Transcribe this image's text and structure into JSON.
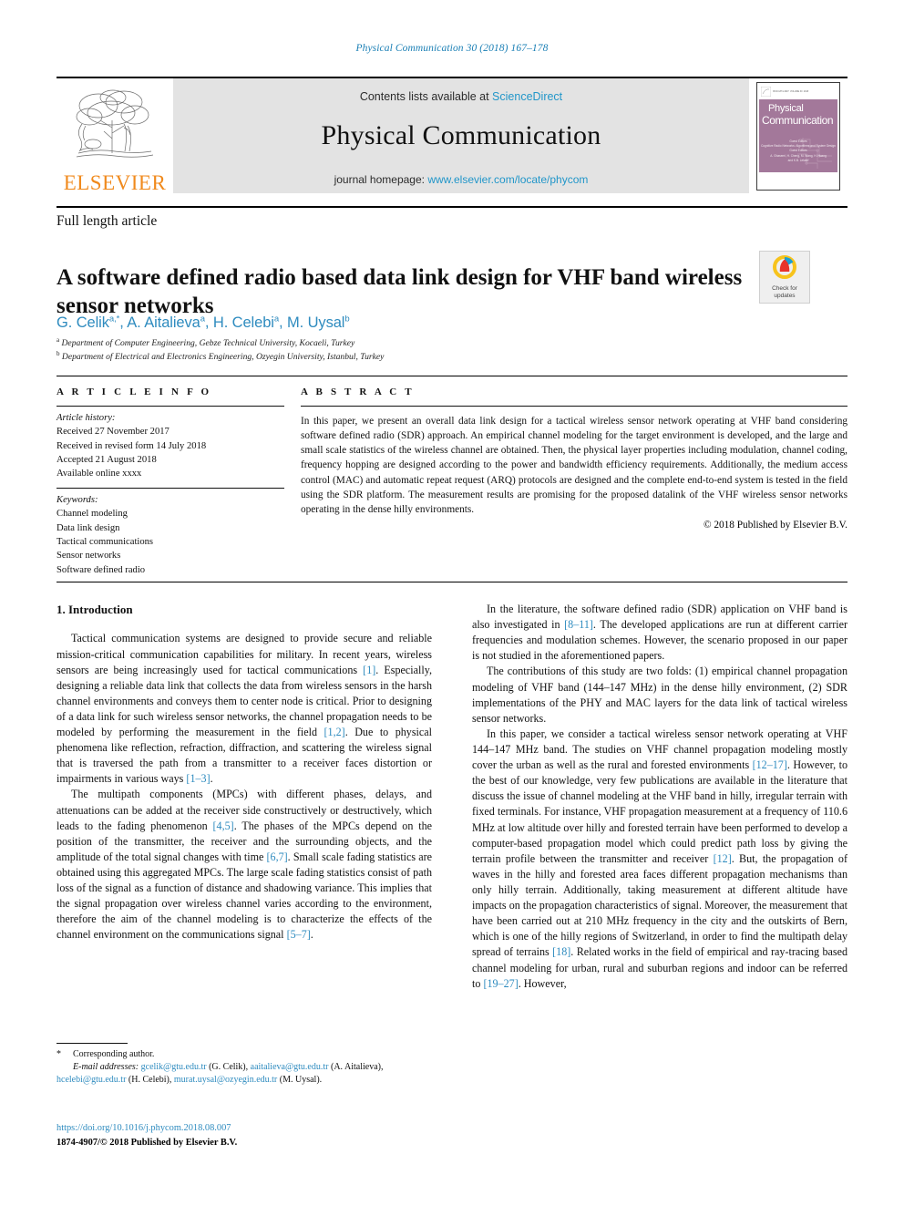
{
  "running_head": "Physical Communication 30 (2018) 167–178",
  "masthead": {
    "contents_prefix": "Contents lists available at ",
    "sciencedirect": "ScienceDirect",
    "journal_title": "Physical Communication",
    "homepage_prefix": "journal homepage: ",
    "homepage_url": "www.elsevier.com/locate/phycom",
    "publisher": "ELSEVIER",
    "cover": {
      "line1": "Physical",
      "line2": "Communication",
      "sub1": "Guest Editors",
      "sub2": "Cognitive Radio Networks: Algorithms and System Design",
      "sub3": "Guest Editors",
      "sub4": "A. Ghasemi, H. Cheng, M. Wang, H. Huang",
      "sub5": "and K.B. Letaief"
    }
  },
  "article_type": "Full length article",
  "title": "A software defined radio based data link design for VHF band wireless sensor networks",
  "check_badge": {
    "line1": "Check for",
    "line2": "updates"
  },
  "authors": "G. Celik a,*, A. Aitalieva a, H. Celebi a, M. Uysal b",
  "affiliations": [
    "a Department of Computer Engineering, Gebze Technical University, Kocaeli, Turkey",
    "b Department of Electrical and Electronics Engineering, Ozyegin University, Istanbul, Turkey"
  ],
  "article_info": {
    "heading": "A R T I C L E   I N F O",
    "history_label": "Article history:",
    "history": [
      "Received 27 November 2017",
      "Received in revised form 14 July 2018",
      "Accepted 21 August 2018",
      "Available online xxxx"
    ],
    "keywords_label": "Keywords:",
    "keywords": [
      "Channel modeling",
      "Data link design",
      "Tactical communications",
      "Sensor networks",
      "Software defined radio"
    ]
  },
  "abstract": {
    "heading": "A B S T R A C T",
    "text": "In this paper, we present an overall data link design for a tactical wireless sensor network operating at VHF band considering software defined radio (SDR) approach. An empirical channel modeling for the target environment is developed, and the large and small scale statistics of the wireless channel are obtained. Then, the physical layer properties including modulation, channel coding, frequency hopping are designed according to the power and bandwidth efficiency requirements. Additionally, the medium access control (MAC) and automatic repeat request (ARQ) protocols are designed and the complete end-to-end system is tested in the field using the SDR platform. The measurement results are promising for the proposed datalink of the VHF wireless sensor networks operating in the dense hilly environments.",
    "copyright": "© 2018 Published by Elsevier B.V."
  },
  "body": {
    "section_number_title": "1.  Introduction",
    "left_paragraphs": [
      "Tactical communication systems are designed to provide secure and reliable mission-critical communication capabilities for military. In recent years, wireless sensors are being increasingly used for tactical communications [1]. Especially, designing a reliable data link that collects the data from wireless sensors in the harsh channel environments and conveys them to center node is critical. Prior to designing of a data link for such wireless sensor networks, the channel propagation needs to be modeled by performing the measurement in the field [1,2]. Due to physical phenomena like reflection, refraction, diffraction, and scattering the wireless signal that is traversed the path from a transmitter to a receiver faces distortion or impairments in various ways [1–3].",
      "The multipath components (MPCs) with different phases, delays, and attenuations can be added at the receiver side constructively or destructively, which leads to the fading phenomenon [4,5]. The phases of the MPCs depend on the position of the transmitter, the receiver and the surrounding objects, and the amplitude of the total signal changes with time [6,7]. Small scale fading statistics are obtained using this aggregated MPCs. The large scale fading statistics consist of path loss of the signal as a function of distance and shadowing variance. This implies that the signal propagation over wireless channel varies according to the environment, therefore the aim of the channel modeling is to characterize the effects of the channel environment on the communications signal [5–7]."
    ],
    "right_paragraphs": [
      "In the literature, the software defined radio (SDR) application on VHF band is also investigated in [8–11]. The developed applications are run at different carrier frequencies and modulation schemes. However, the scenario proposed in our paper is not studied in the aforementioned papers.",
      "The contributions of this study are two folds: (1) empirical channel propagation modeling of VHF band (144–147 MHz) in the dense hilly environment, (2) SDR implementations of the PHY and MAC layers for the data link of tactical wireless sensor networks.",
      "In this paper, we consider a tactical wireless sensor network operating at VHF 144–147 MHz band. The studies on VHF channel propagation modeling mostly cover the urban as well as the rural and forested environments [12–17]. However, to the best of our knowledge, very few publications are available in the literature that discuss the issue of channel modeling at the VHF band in hilly, irregular terrain with fixed terminals. For instance, VHF propagation measurement at a frequency of 110.6 MHz at low altitude over hilly and forested terrain have been performed to develop a computer-based propagation model which could predict path loss by giving the terrain profile between the transmitter and receiver [12]. But, the propagation of waves in the hilly and forested area faces different propagation mechanisms than only hilly terrain. Additionally, taking measurement at different altitude have impacts on the propagation characteristics of signal. Moreover, the measurement that have been carried out at 210 MHz frequency in the city and the outskirts of Bern, which is one of the hilly regions of Switzerland, in order to find the multipath delay spread of terrains [18]. Related works in the field of empirical and ray-tracing based channel modeling for urban, rural and suburban regions and indoor can be referred to [19–27]. However,"
    ]
  },
  "footnote": {
    "corresponding": "Corresponding author.",
    "email_label": "E-mail addresses:",
    "emails": [
      {
        "addr": "gcelik@gtu.edu.tr",
        "who": " (G. Celik), "
      },
      {
        "addr": "aaitalieva@gtu.edu.tr",
        "who": " (A. Aitalieva), "
      },
      {
        "addr": "hcelebi@gtu.edu.tr",
        "who": " (H. Celebi), "
      },
      {
        "addr": "murat.uysal@ozyegin.edu.tr",
        "who": " (M. Uysal)."
      }
    ],
    "doi": "https://doi.org/10.1016/j.phycom.2018.08.007",
    "issn_line": "1874-4907/© 2018 Published by Elsevier B.V."
  },
  "colors": {
    "link": "#2e8bbf",
    "sciencedirect": "#2196c9",
    "elsevier_orange": "#f08a1d",
    "band_gray": "#e3e3e3",
    "cover_purple": "#a3789a"
  }
}
